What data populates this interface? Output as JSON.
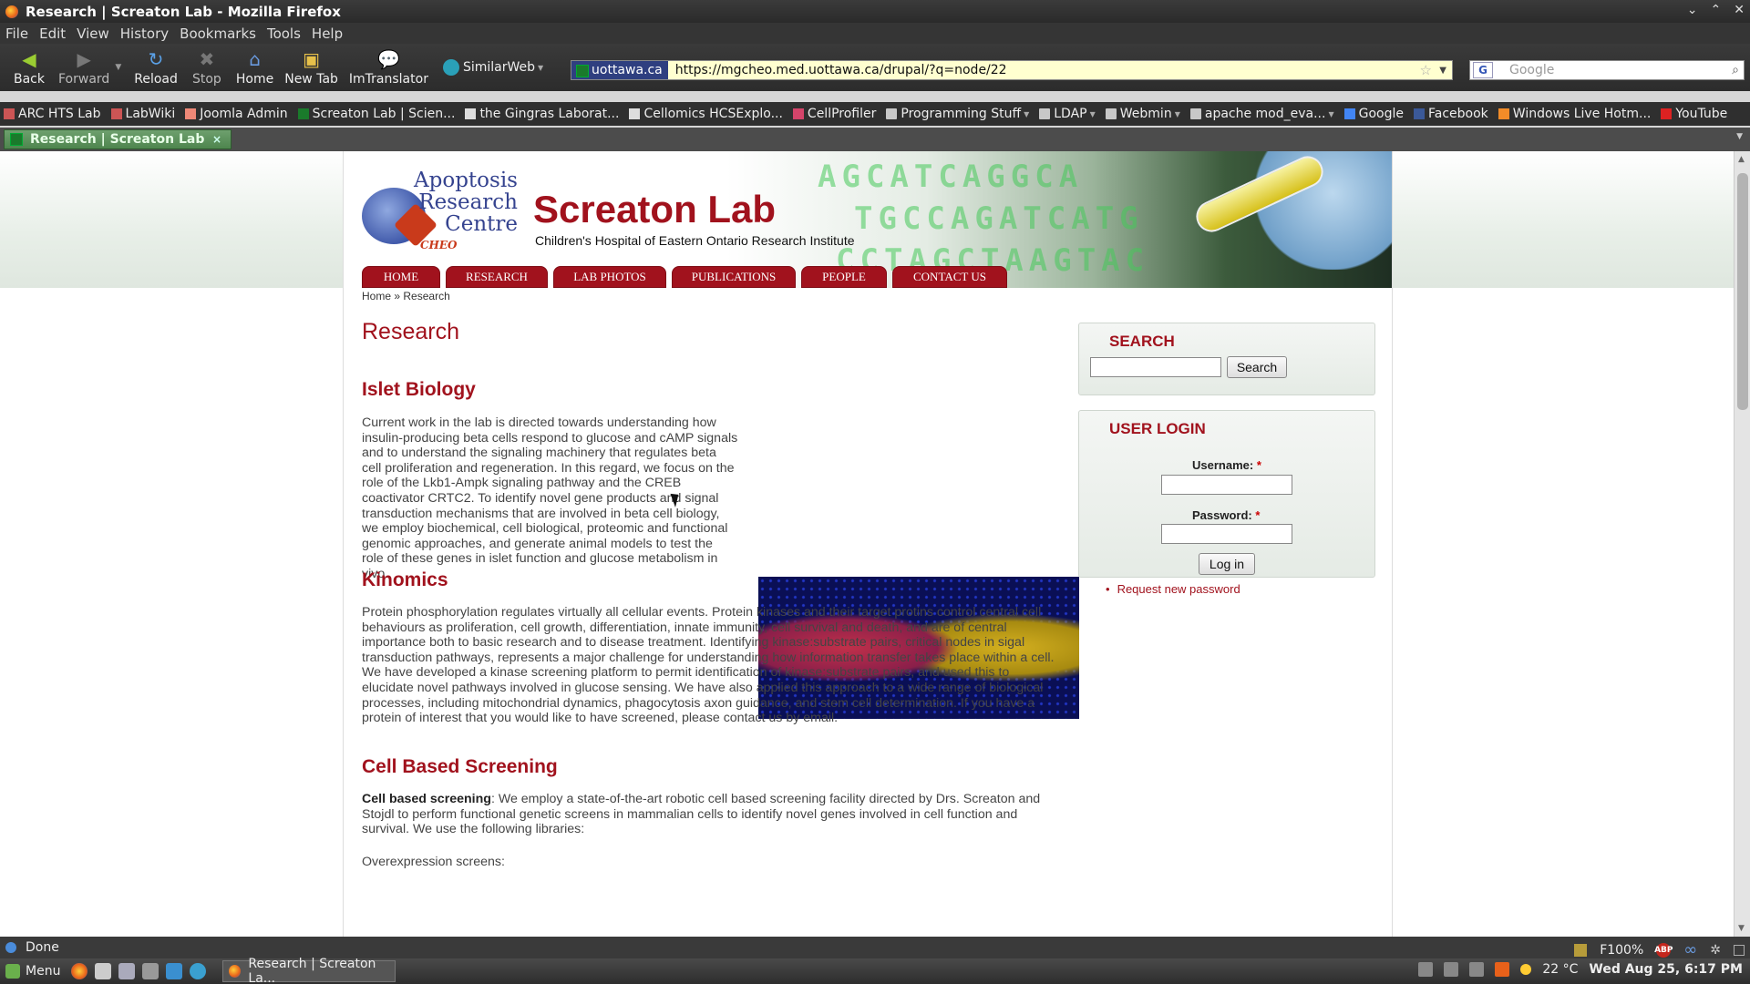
{
  "window": {
    "title": "Research | Screaton Lab - Mozilla Firefox",
    "controls": [
      "⌄",
      "⌃",
      "✕"
    ]
  },
  "menubar": [
    "File",
    "Edit",
    "View",
    "History",
    "Bookmarks",
    "Tools",
    "Help"
  ],
  "toolbar": {
    "back": "Back",
    "forward": "Forward",
    "reload": "Reload",
    "stop": "Stop",
    "home": "Home",
    "new_tab": "New Tab",
    "imtranslator": "ImTranslator",
    "similarweb": "SimilarWeb"
  },
  "urlbar": {
    "site": "uottawa.ca",
    "url": "https://mgcheo.med.uottawa.ca/drupal/?q=node/22"
  },
  "searchbar": {
    "placeholder": "Google"
  },
  "bookmarks": [
    {
      "label": "ARC HTS Lab",
      "icon": "grid-icon"
    },
    {
      "label": "LabWiki",
      "icon": "grid-icon"
    },
    {
      "label": "Joomla Admin",
      "icon": "joomla-icon"
    },
    {
      "label": "Screaton Lab | Scien...",
      "icon": "leaf-icon"
    },
    {
      "label": "the Gingras Laborat...",
      "icon": "page-icon"
    },
    {
      "label": "Cellomics HCSExplo...",
      "icon": "page-icon"
    },
    {
      "label": "CellProfiler",
      "icon": "cell-icon"
    },
    {
      "label": "Programming Stuff",
      "icon": "folder-icon",
      "folder": true
    },
    {
      "label": "LDAP",
      "icon": "folder-icon",
      "folder": true
    },
    {
      "label": "Webmin",
      "icon": "folder-icon",
      "folder": true
    },
    {
      "label": "apache mod_eva...",
      "icon": "folder-icon",
      "folder": true
    },
    {
      "label": "Google",
      "icon": "google-icon"
    },
    {
      "label": "Facebook",
      "icon": "facebook-icon"
    },
    {
      "label": "Windows Live Hotm...",
      "icon": "hotmail-icon"
    },
    {
      "label": "YouTube",
      "icon": "youtube-icon"
    }
  ],
  "tab": {
    "label": "Research | Screaton Lab",
    "close": "×"
  },
  "site": {
    "logo_text": "Apoptosis Research Centre",
    "logo_sub": "CHEO",
    "name": "Screaton Lab",
    "slogan": "Children's Hospital of Eastern Ontario Research Institute",
    "dna_rows": [
      "AGCATCAGGCA",
      "TGCCAGATCATG",
      "CCTAGCTAAGTAC"
    ],
    "nav": [
      "HOME",
      "RESEARCH",
      "LAB PHOTOS",
      "PUBLICATIONS",
      "PEOPLE",
      "CONTACT US"
    ],
    "breadcrumb": [
      "Home",
      "»",
      "Research"
    ],
    "page_title": "Research",
    "sections": {
      "islet_title": "Islet Biology",
      "islet_lines": [
        "Current work in the lab is directed towards understanding how",
        "insulin-producing beta cells respond to glucose and cAMP signals",
        "and to understand the signaling machinery that regulates beta",
        "cell proliferation and regeneration. In this regard, we focus on the",
        "role of the Lkb1-Ampk signaling pathway and the CREB",
        "coactivator CRTC2. To identify novel gene products and signal",
        "transduction mechanisms that are involved in beta cell biology,",
        "we employ biochemical, cell biological, proteomic and functional",
        "genomic approaches, and generate animal models to test the",
        "role of these genes in islet function and glucose metabolism in",
        "vivo."
      ],
      "kinomics_title": "Kinomics",
      "kinomics_lines": [
        "Protein phosphorylation regulates virtually all cellular events. Protein kinases and their target protins control central cell",
        "behaviours as proliferation, cell growth, differentiation, innate immunity, cell survival and death, and are of central",
        "importance both to basic research and to disease treatment. Identifying kinase:substrate pairs, critical nodes in sigal",
        "transduction pathways, represents a major challenge for understanding how information transfer takes place within a cell.",
        "We have developed a kinase screening platform to permit identification of kinase:substrate pairs, and used this to",
        "elucidate novel pathways involved in glucose sensing. We have also applied this approach to a wide range of biological",
        "processes, including mitochondrial dynamics, phagocytosis axon guidance, and stem cell determination. If you have a",
        "protein of interest that you would like to have screened, please contact us by email."
      ],
      "cbs_title": "Cell Based Screening",
      "cbs_bold": "Cell based screening",
      "cbs_lines": [
        ": We employ a state-of-the-art robotic cell based screening facility directed by Drs. Screaton and",
        "Stojdl to perform functional genetic screens in mammalian cells to identify novel genes involved in cell function and",
        "survival. We use the following libraries:"
      ],
      "overexpression": "Overexpression screens:"
    },
    "search_block": {
      "title": "SEARCH",
      "button": "Search"
    },
    "login_block": {
      "title": "USER LOGIN",
      "username_label": "Username: ",
      "password_label": "Password: ",
      "required_mark": "*",
      "login_button": "Log in",
      "request_password": "Request new password"
    }
  },
  "statusbar": {
    "text": "Done",
    "zoom": "F100%",
    "abp": "ABP"
  },
  "taskbar": {
    "menu": "Menu",
    "task": "Research | Screaton La...",
    "weather": "22 °C",
    "clock": "Wed Aug 25,  6:17 PM"
  },
  "colors": {
    "brand_red": "#a1121d",
    "url_bg": "#ffffd0",
    "tab_green": "#4e854e"
  }
}
